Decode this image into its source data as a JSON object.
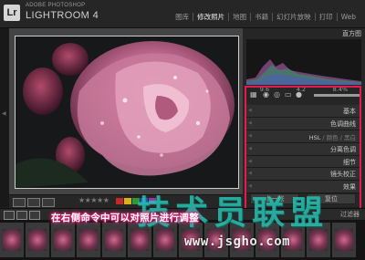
{
  "app": {
    "adobe_line": "ADOBE PHOTOSHOP",
    "product_name": "LIGHTROOM 4",
    "logo": "Lr"
  },
  "modules": [
    {
      "label": "图库",
      "active": false
    },
    {
      "label": "修改照片",
      "active": true
    },
    {
      "label": "地图",
      "active": false
    },
    {
      "label": "书籍",
      "active": false
    },
    {
      "label": "幻灯片放映",
      "active": false
    },
    {
      "label": "打印",
      "active": false
    },
    {
      "label": "Web",
      "active": false
    }
  ],
  "histogram": {
    "title": "直方图",
    "info": [
      "9.6",
      "4.2",
      "8.4%"
    ]
  },
  "panels": {
    "sections": [
      "基本",
      "色调曲线",
      "HSL / 颜色 / 黑白",
      "分离色调",
      "细节",
      "镜头校正",
      "效果"
    ],
    "hsl_parts": [
      "HSL",
      "颜色",
      "黑白"
    ]
  },
  "buttons": {
    "previous": "上一张",
    "reset": "复位"
  },
  "filmstrip": {
    "filter_label": "过滤器",
    "thumb_count": 14
  },
  "overlay": {
    "caption": "在右侧命令中可以对照片进行调整",
    "watermark_cn": "技术员联盟",
    "watermark_url": "www.jsgho.com"
  },
  "colors": {
    "highlight": "#e8194e",
    "label_red": "#c62828",
    "label_yellow": "#d9b11a",
    "label_green": "#2e9a35",
    "label_blue": "#2a56c9",
    "label_purple": "#8b3aa8"
  },
  "icons": [
    "crop-icon",
    "spot-removal-icon",
    "red-eye-icon",
    "graduated-filter-icon",
    "radial-icon",
    "brush-icon"
  ]
}
